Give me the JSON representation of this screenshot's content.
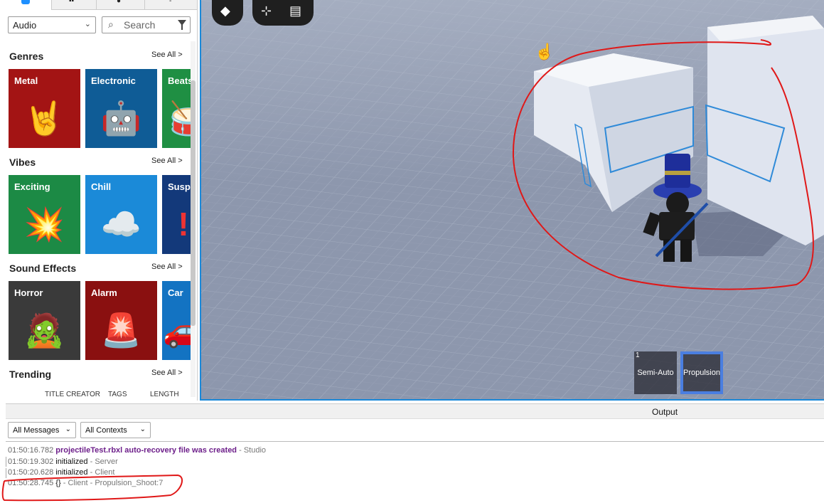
{
  "toolbox": {
    "category": "Audio",
    "search_placeholder": "Search",
    "sections": [
      {
        "title": "Genres",
        "see_all": "See All >",
        "tiles": [
          {
            "label": "Metal",
            "color": "#a31414",
            "icon": "rock-hand-icon"
          },
          {
            "label": "Electronic",
            "color": "#0f5c96",
            "icon": "robot-icon"
          },
          {
            "label": "Beats",
            "color": "#1f8f43",
            "icon": "drum-icon"
          }
        ]
      },
      {
        "title": "Vibes",
        "see_all": "See All >",
        "tiles": [
          {
            "label": "Exciting",
            "color": "#1c8a45",
            "icon": "explosion-icon"
          },
          {
            "label": "Chill",
            "color": "#1b8ad8",
            "icon": "cloud-icon"
          },
          {
            "label": "Susp",
            "color": "#13397a",
            "icon": "exclamation-icon"
          }
        ]
      },
      {
        "title": "Sound Effects",
        "see_all": "See All >",
        "tiles": [
          {
            "label": "Horror",
            "color": "#3a3a3a",
            "icon": "zombie-icon"
          },
          {
            "label": "Alarm",
            "color": "#8a1010",
            "icon": "siren-icon"
          },
          {
            "label": "Car",
            "color": "#1373c2",
            "icon": "car-icon"
          }
        ]
      },
      {
        "title": "Trending",
        "see_all": "See All >",
        "tiles": []
      }
    ],
    "columns": [
      "TITLE",
      "CREATOR",
      "TAGS",
      "LENGTH"
    ]
  },
  "viewport": {
    "hotbar": [
      {
        "number": "1",
        "label": "Semi-Auto",
        "selected": false
      },
      {
        "number": "",
        "label": "Propulsion",
        "selected": true
      }
    ]
  },
  "output": {
    "title": "Output",
    "message_filter": "All Messages",
    "context_filter": "All Contexts",
    "logs": [
      {
        "time": "01:50:16.782",
        "message": "projectileTest.rbxl auto-recovery file was created",
        "source": "- Studio",
        "highlight": true
      },
      {
        "time": "01:50:19.302",
        "message": "initialized",
        "source": "- Server",
        "highlight": false
      },
      {
        "time": "01:50:20.628",
        "message": "initialized",
        "source": "- Client",
        "highlight": false
      },
      {
        "time": "01:50:28.745",
        "message": "{}",
        "source": "- Client - Propulsion_Shoot:7",
        "highlight": false
      }
    ]
  }
}
